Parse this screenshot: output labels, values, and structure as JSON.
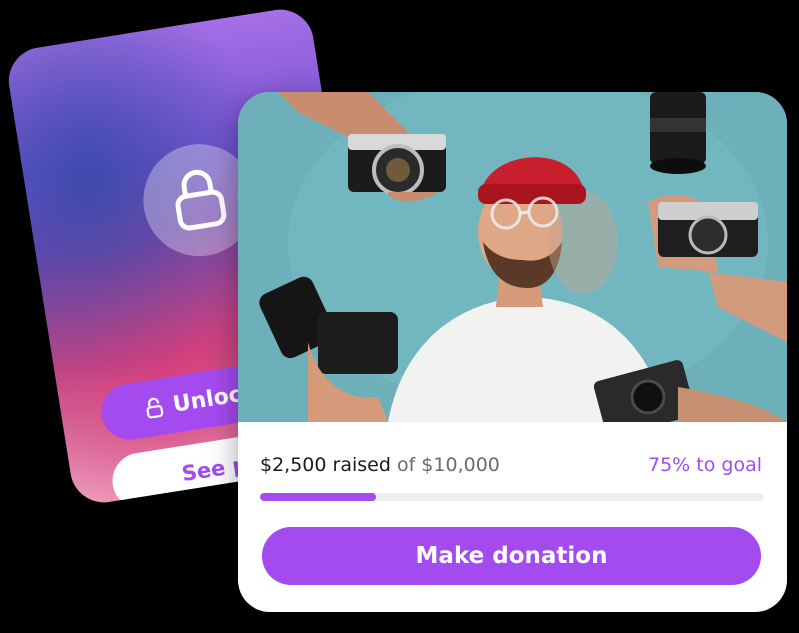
{
  "locked_card": {
    "unlock_label": "Unlock",
    "preview_label": "See pre",
    "lock_icon": "lock-icon",
    "small_lock_icon": "lock-open-icon"
  },
  "donation_card": {
    "photo_icon": "photo-of-man-with-cameras",
    "raised": "$2,500 raised",
    "of_goal": "of $10,000",
    "goal_percent_text": "75% to goal",
    "progress_fraction": 0.23,
    "button_label": "Make donation"
  },
  "colors": {
    "accent": "#a44bef",
    "progress_track": "#eeeeef",
    "photo_background": "#6fb3bd"
  }
}
